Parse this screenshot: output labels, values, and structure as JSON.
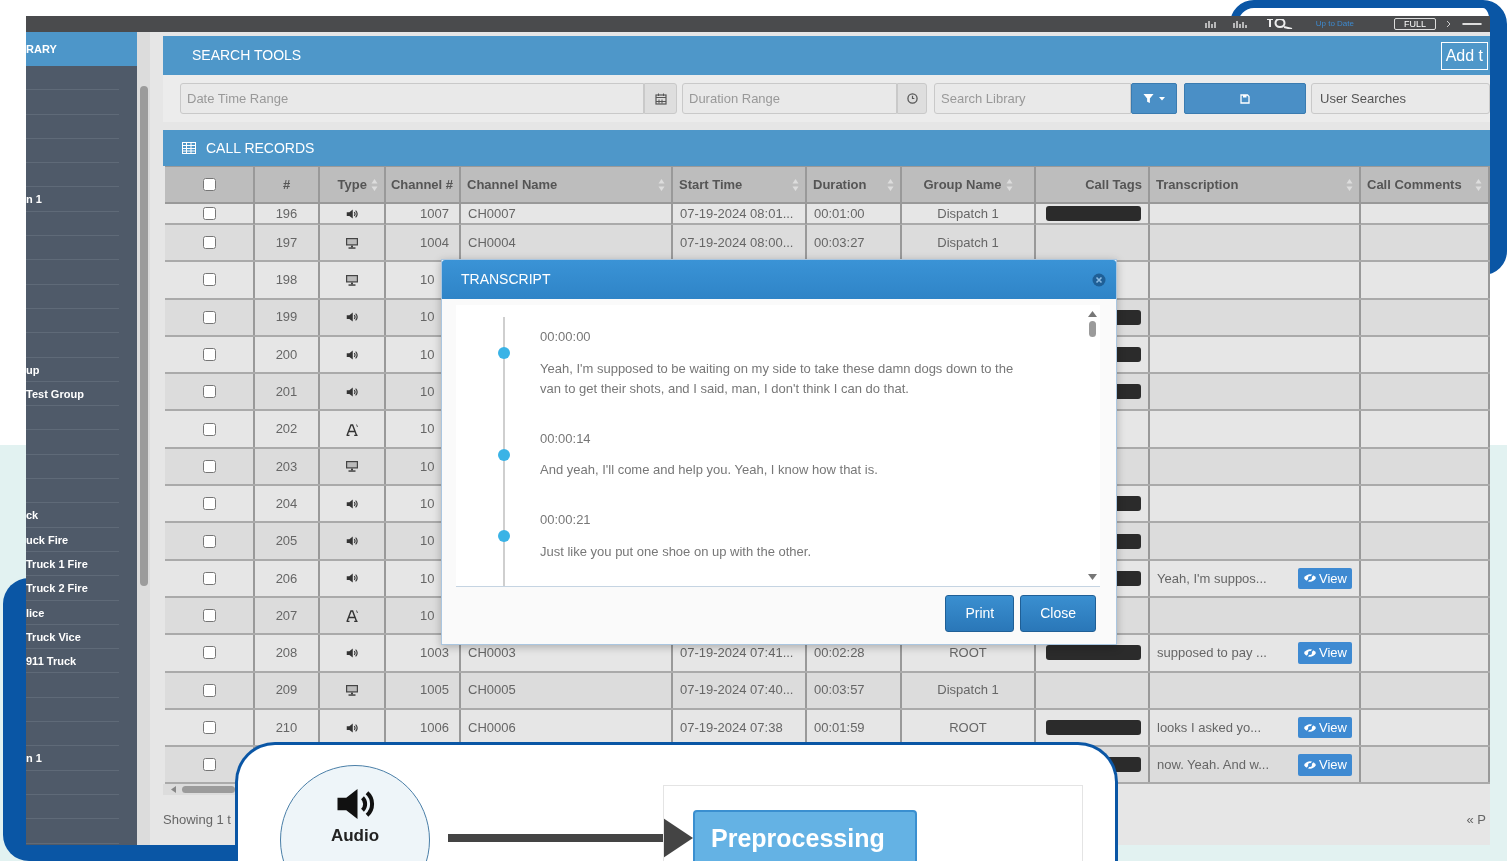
{
  "top_bar": {
    "status": "Up to Date",
    "mode_button": "FULL"
  },
  "sidebar": {
    "title": "RARY",
    "items": [
      {
        "kind": "blank"
      },
      {
        "kind": "blank"
      },
      {
        "kind": "blank"
      },
      {
        "kind": "blank"
      },
      {
        "kind": "blank"
      },
      {
        "kind": "entry",
        "label": "n 1"
      },
      {
        "kind": "blank"
      },
      {
        "kind": "blank"
      },
      {
        "kind": "blank"
      },
      {
        "kind": "blank"
      },
      {
        "kind": "blank"
      },
      {
        "kind": "blank"
      },
      {
        "kind": "entry",
        "label": "up"
      },
      {
        "kind": "entry",
        "label": "Test Group"
      },
      {
        "kind": "blank"
      },
      {
        "kind": "blank"
      },
      {
        "kind": "blank"
      },
      {
        "kind": "blank"
      },
      {
        "kind": "entry",
        "label": "ck"
      },
      {
        "kind": "entry",
        "label": "uck Fire"
      },
      {
        "kind": "entry",
        "label": "Truck 1 Fire"
      },
      {
        "kind": "entry",
        "label": "Truck 2 Fire"
      },
      {
        "kind": "entry",
        "label": "lice"
      },
      {
        "kind": "entry",
        "label": "Truck Vice"
      },
      {
        "kind": "entry",
        "label": "911 Truck"
      },
      {
        "kind": "blank"
      },
      {
        "kind": "blank"
      },
      {
        "kind": "blank"
      },
      {
        "kind": "entry",
        "label": "n 1"
      },
      {
        "kind": "blank"
      },
      {
        "kind": "blank"
      },
      {
        "kind": "blank"
      }
    ]
  },
  "search_tools": {
    "title": "SEARCH TOOLS",
    "add_button": "Add t",
    "date_range": {
      "placeholder": "Date Time Range"
    },
    "duration_range": {
      "placeholder": "Duration Range"
    },
    "search": {
      "placeholder": "Search Library"
    },
    "user_searches": {
      "value": "User Searches"
    }
  },
  "call_records": {
    "title": "CALL RECORDS",
    "columns": [
      {
        "kind": "select",
        "checked": false
      },
      {
        "kind": "text",
        "label": "#",
        "sortable": false
      },
      {
        "kind": "text",
        "label": "Type",
        "sortable": true
      },
      {
        "kind": "text",
        "label": "Channel #",
        "sortable": false
      },
      {
        "kind": "text",
        "label": "Channel Name",
        "sortable": true
      },
      {
        "kind": "text",
        "label": "Start Time",
        "sortable": true
      },
      {
        "kind": "text",
        "label": "Duration",
        "sortable": true
      },
      {
        "kind": "text",
        "label": "Group Name",
        "sortable": true
      },
      {
        "kind": "text",
        "label": "Call Tags",
        "sortable": false
      },
      {
        "kind": "text",
        "label": "Transcription",
        "sortable": true
      },
      {
        "kind": "text",
        "label": "Call Comments",
        "sortable": true
      }
    ],
    "rows": [
      {
        "checked": false,
        "number": "196",
        "kind": "audio",
        "channel": "1007",
        "name": "CH0007",
        "start": "07-19-2024 08:01...",
        "duration": "00:01:00",
        "group": "Dispatch 1",
        "tagged": true
      },
      {
        "checked": false,
        "number": "197",
        "kind": "screen",
        "channel": "1004",
        "name": "CH0004",
        "start": "07-19-2024 08:00...",
        "duration": "00:03:27",
        "group": "Dispatch 1",
        "tagged": false
      },
      {
        "checked": false,
        "number": "198",
        "kind": "screen",
        "channel": "10",
        "tagged": false
      },
      {
        "checked": false,
        "number": "199",
        "kind": "audio",
        "channel": "10",
        "tagged": true
      },
      {
        "checked": false,
        "number": "200",
        "kind": "audio",
        "channel": "10",
        "tagged": true
      },
      {
        "checked": false,
        "number": "201",
        "kind": "audio",
        "channel": "10",
        "tagged": true
      },
      {
        "checked": false,
        "number": "202",
        "kind": "text",
        "channel": "10",
        "tagged": false
      },
      {
        "checked": false,
        "number": "203",
        "kind": "screen",
        "channel": "10",
        "tagged": false
      },
      {
        "checked": false,
        "number": "204",
        "kind": "audio",
        "channel": "10",
        "tagged": true
      },
      {
        "checked": false,
        "number": "205",
        "kind": "audio",
        "channel": "10",
        "tagged": true
      },
      {
        "checked": false,
        "number": "206",
        "kind": "audio",
        "channel": "10",
        "tagged": true,
        "transcription": "Yeah, I'm suppos...",
        "view": "View"
      },
      {
        "checked": false,
        "number": "207",
        "kind": "text",
        "channel": "10",
        "tagged": false
      },
      {
        "checked": false,
        "number": "208",
        "kind": "audio",
        "channel": "1003",
        "name": "CH0003",
        "start": "07-19-2024 07:41...",
        "duration": "00:02:28",
        "group": "ROOT",
        "tagged": true,
        "transcription": "supposed to pay ...",
        "view": "View"
      },
      {
        "checked": false,
        "number": "209",
        "kind": "screen",
        "channel": "1005",
        "name": "CH0005",
        "start": "07-19-2024 07:40...",
        "duration": "00:03:57",
        "group": "Dispatch 1",
        "tagged": false
      },
      {
        "checked": false,
        "number": "210",
        "kind": "audio",
        "channel": "1006",
        "name": "CH0006",
        "start": "07-19-2024 07:38",
        "duration": "00:01:59",
        "group": "ROOT",
        "tagged": true,
        "transcription": "looks I asked yo...",
        "view": "View"
      },
      {
        "checked": false,
        "tagged": true,
        "transcription": "now. Yeah. And w...",
        "view": "View"
      }
    ],
    "footer": "Showing 1 t",
    "pagination": "« P"
  },
  "transcript_dialog": {
    "title": "TRANSCRIPT",
    "entries": [
      {
        "time": "00:00:00",
        "text": "Yeah, I'm supposed to be waiting on my side to take these damn dogs down to the van to get their shots, and I said, man, I don't think I can do that."
      },
      {
        "time": "00:00:14",
        "text": "And yeah, I'll come and help you. Yeah, I know how that is."
      },
      {
        "time": "00:00:21",
        "text": "Just like you put one shoe on up with the other."
      }
    ],
    "buttons": [
      "Print",
      "Close"
    ]
  },
  "diagram": {
    "source_label": "Audio",
    "step_label": "Preprocessing"
  }
}
